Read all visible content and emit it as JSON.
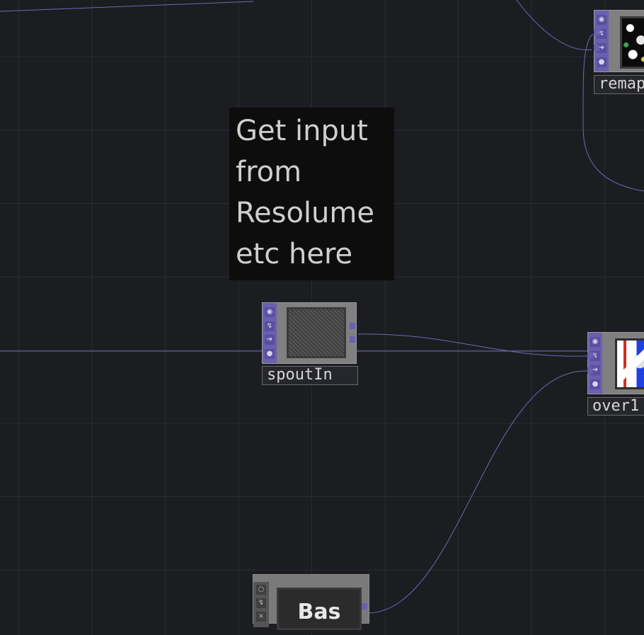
{
  "network": {
    "background_color": "#1c1d21",
    "grid_color": "#2a2b31",
    "wire_color": "#6e6ab8"
  },
  "comment": {
    "text_lines": [
      "Get input",
      "from",
      "Resolume",
      "etc here"
    ]
  },
  "nodes": {
    "spout_in": {
      "label": "spoutIn",
      "family": "TOP",
      "flag_color": "#6a5fb0"
    },
    "remap": {
      "label": "remap",
      "family": "TOP",
      "flag_color": "#6a5fb0"
    },
    "over": {
      "label": "over1",
      "family": "TOP",
      "flag_color": "#6a5fb0"
    },
    "bas": {
      "preview_text": "Bas",
      "family": "COMP"
    }
  },
  "flag_icons": [
    "viewer-icon",
    "bypass-icon",
    "cook-icon",
    "lock-icon"
  ],
  "comp_flag_icons": [
    "viewer-icon",
    "bypass-icon",
    "close-icon"
  ]
}
